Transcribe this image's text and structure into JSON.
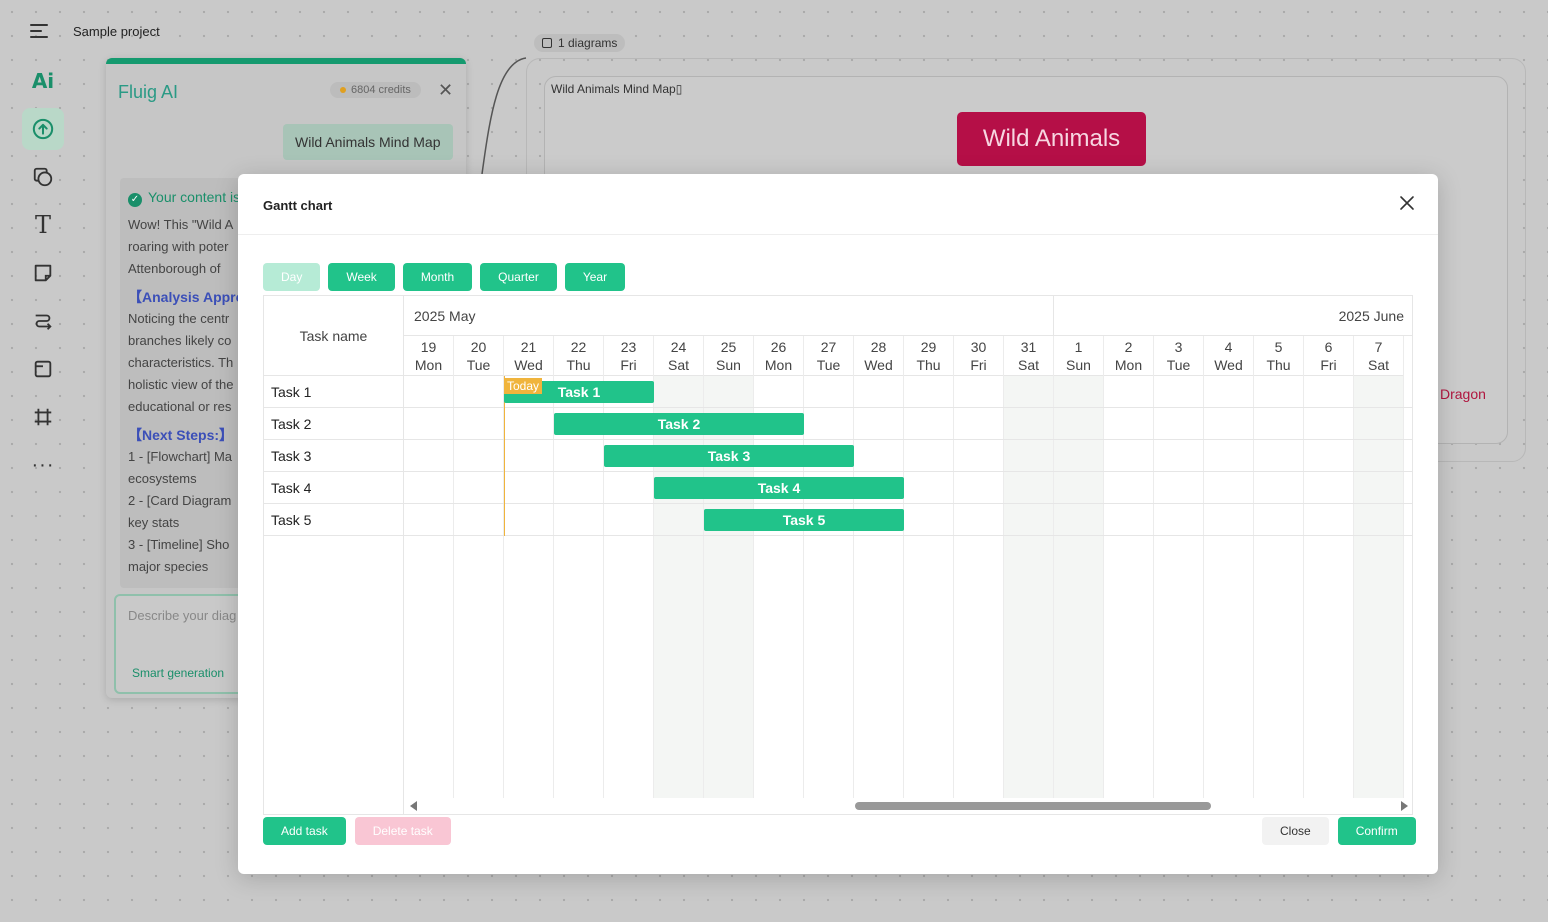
{
  "app": {
    "project_title": "Sample project",
    "diagram_count": "1 diagrams"
  },
  "ai_panel": {
    "title": "Fluig AI",
    "credits": "6804 credits",
    "user_message": "Wild Animals Mind Map",
    "status": "Your content is",
    "lines": [
      "Wow! This \"Wild A",
      "roaring with poter",
      "Attenborough of "
    ],
    "analysis_heading": "【Analysis Appro",
    "analysis_lines": [
      "Noticing the centr",
      "branches likely co",
      "characteristics. Th",
      "holistic view of the",
      "educational or res"
    ],
    "next_heading": "【Next Steps:】",
    "next_lines": [
      "1 - [Flowchart] Ma",
      "ecosystems",
      "2 - [Card Diagram",
      "key stats",
      "3 - [Timeline] Sho",
      "major species"
    ],
    "input_placeholder": "Describe your diag",
    "smart_generation": "Smart generation"
  },
  "canvas": {
    "frame_label": "Wild Animals Mind Map▯",
    "root_node": "Wild Animals",
    "partial_node": "Dragon"
  },
  "modal": {
    "title": "Gantt chart",
    "view_buttons": [
      "Day",
      "Week",
      "Month",
      "Quarter",
      "Year"
    ],
    "task_name_header": "Task name",
    "months": [
      "2025 May",
      "2025 June"
    ],
    "days": [
      {
        "num": "19",
        "dow": "Mon"
      },
      {
        "num": "20",
        "dow": "Tue"
      },
      {
        "num": "21",
        "dow": "Wed"
      },
      {
        "num": "22",
        "dow": "Thu"
      },
      {
        "num": "23",
        "dow": "Fri"
      },
      {
        "num": "24",
        "dow": "Sat"
      },
      {
        "num": "25",
        "dow": "Sun"
      },
      {
        "num": "26",
        "dow": "Mon"
      },
      {
        "num": "27",
        "dow": "Tue"
      },
      {
        "num": "28",
        "dow": "Wed"
      },
      {
        "num": "29",
        "dow": "Thu"
      },
      {
        "num": "30",
        "dow": "Fri"
      },
      {
        "num": "31",
        "dow": "Sat"
      },
      {
        "num": "1",
        "dow": "Sun"
      },
      {
        "num": "2",
        "dow": "Mon"
      },
      {
        "num": "3",
        "dow": "Tue"
      },
      {
        "num": "4",
        "dow": "Wed"
      },
      {
        "num": "5",
        "dow": "Thu"
      },
      {
        "num": "6",
        "dow": "Fri"
      },
      {
        "num": "7",
        "dow": "Sat"
      }
    ],
    "weekend_day_indices": [
      5,
      6,
      12,
      13,
      19
    ],
    "today_label": "Today",
    "today_day_index": 2,
    "tasks": [
      {
        "name": "Task 1",
        "start_day_index": 2,
        "duration_days": 3
      },
      {
        "name": "Task 2",
        "start_day_index": 3,
        "duration_days": 5
      },
      {
        "name": "Task 3",
        "start_day_index": 4,
        "duration_days": 5
      },
      {
        "name": "Task 4",
        "start_day_index": 5,
        "duration_days": 5
      },
      {
        "name": "Task 5",
        "start_day_index": 6,
        "duration_days": 4
      }
    ],
    "add_task": "Add task",
    "delete_task": "Delete task",
    "close": "Close",
    "confirm": "Confirm",
    "accent_color": "#21c38a",
    "today_color": "#f0b43c"
  }
}
